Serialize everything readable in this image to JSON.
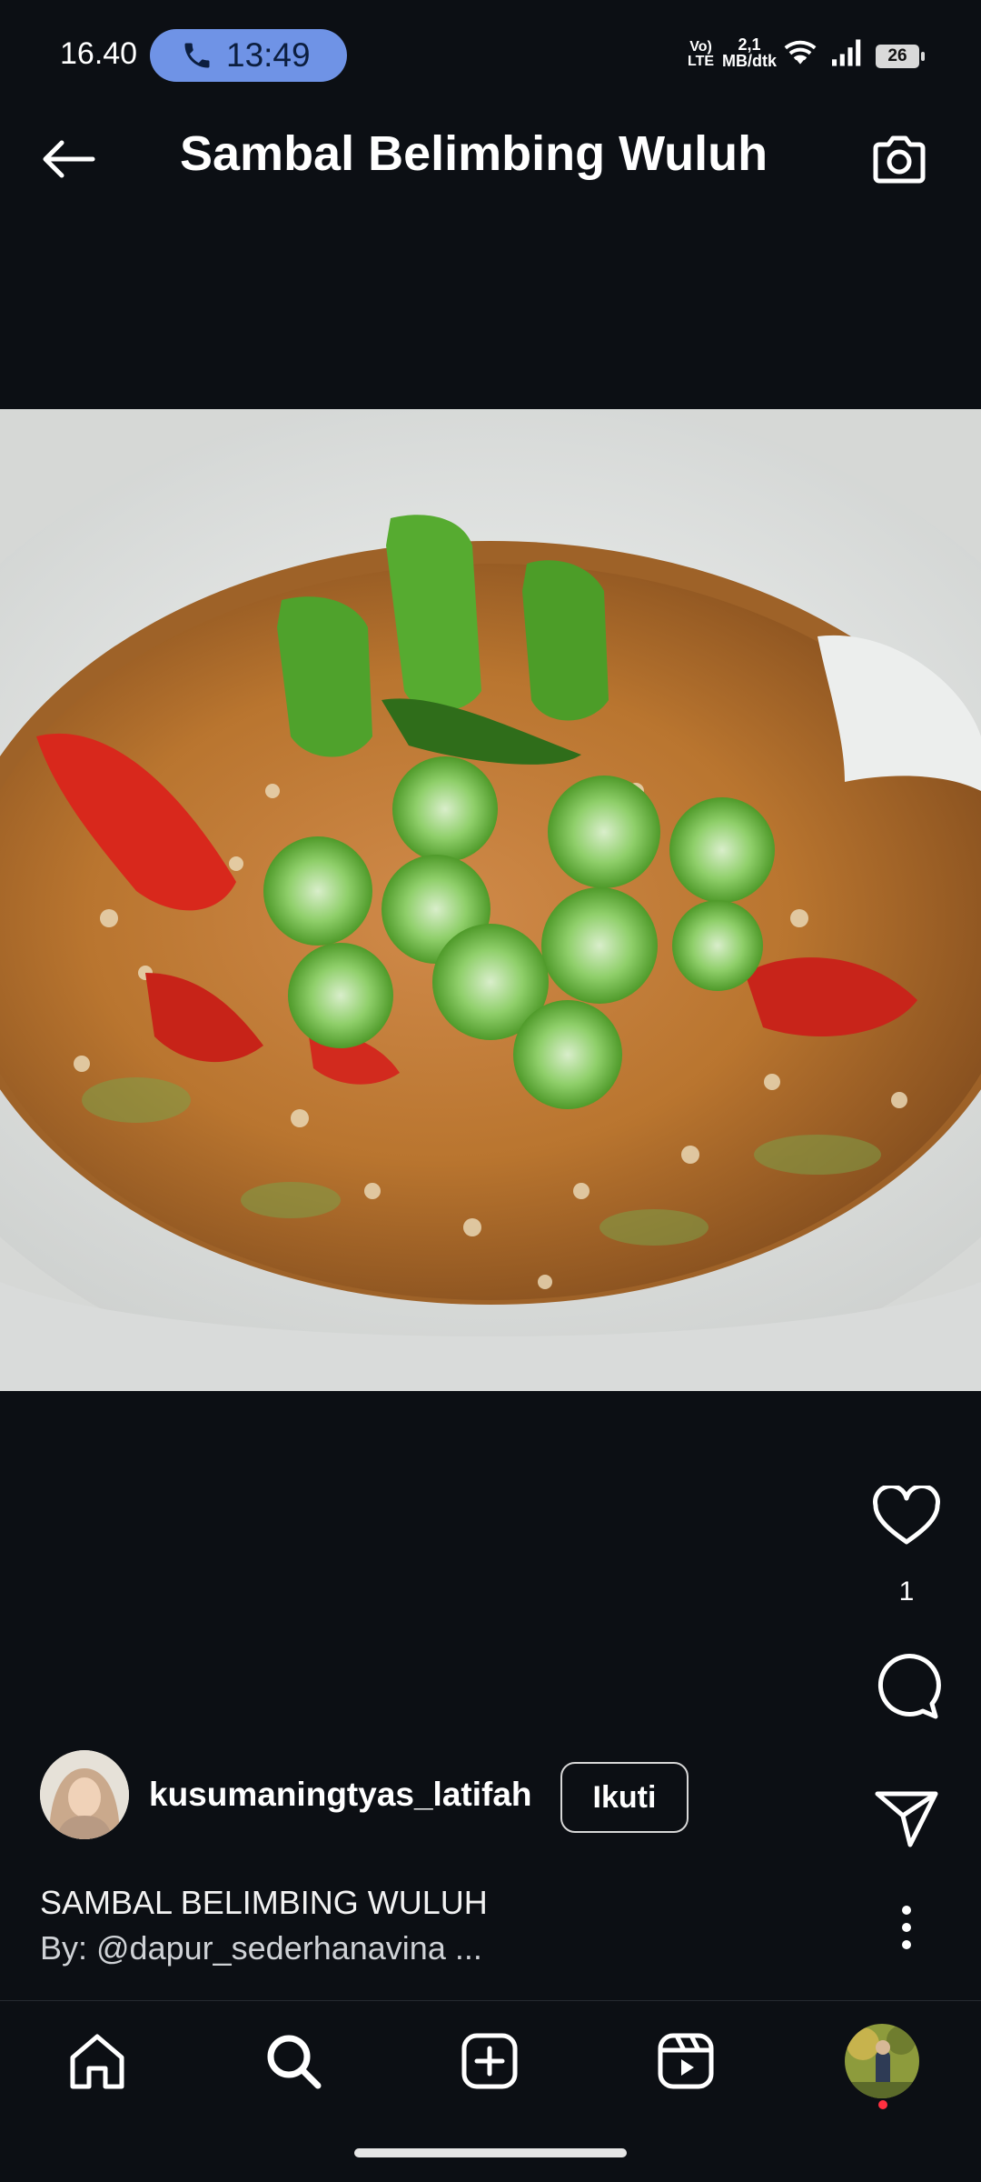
{
  "status_bar": {
    "time": "16.40",
    "call_time": "13:49",
    "network_tag_top": "Vo)",
    "network_tag_bottom": "LTE",
    "speed_value": "2,1",
    "speed_unit": "MB/dtk",
    "battery": "26"
  },
  "header": {
    "title": "Sambal Belimbing Wuluh",
    "back_icon": "arrow-left-icon",
    "camera_icon": "camera-icon"
  },
  "post": {
    "image_description_icon": "food-photo",
    "like_count": "1",
    "author": {
      "username": "kusumaningtyas_latifah",
      "follow_label": "Ikuti"
    },
    "caption": {
      "line1": "SAMBAL BELIMBING WULUH",
      "prefix": "By: ",
      "mention": "@dapur_sederhanavina ..."
    }
  },
  "nav": {
    "items": [
      "home-icon",
      "search-icon",
      "create-icon",
      "reels-icon",
      "profile-avatar"
    ]
  },
  "colors": {
    "background": "#0c0f14",
    "call_pill": "#6f93e6",
    "notification_dot": "#ff3040"
  }
}
